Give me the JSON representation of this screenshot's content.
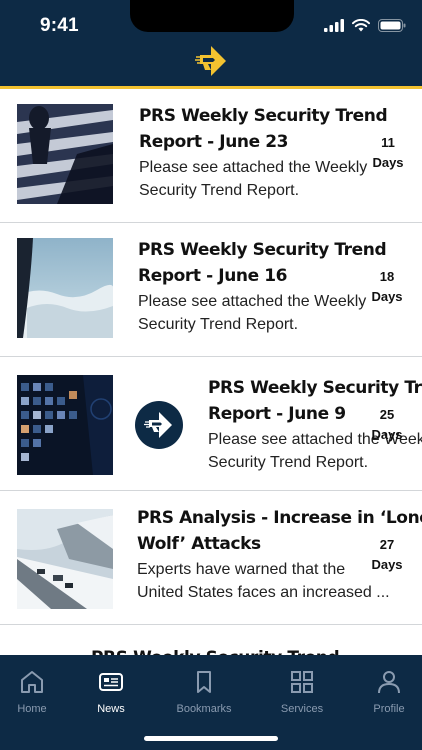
{
  "status_bar": {
    "time": "9:41"
  },
  "colors": {
    "navy": "#0d2a45",
    "accent": "#f2c230",
    "tab_inactive": "#8a9bb0"
  },
  "articles": [
    {
      "title_line1": "PRS Weekly Security Trend",
      "title_line2": "Report - June 23",
      "desc_line1": "Please see attached the Weekly",
      "desc_line2": "Security Trend Report.",
      "days_num": "11",
      "days_label": "Days",
      "thumb": "crosswalk-pedestrian-image"
    },
    {
      "title_line1": "PRS Weekly Security Trend",
      "title_line2": "Report - June 16",
      "desc_line1": "Please see attached the Weekly",
      "desc_line2": "Security Trend Report.",
      "days_num": "18",
      "days_label": "Days",
      "thumb": "aerial-clouds-image"
    },
    {
      "title_line1": "PRS Weekly Security Trend",
      "title_line2": "Report - June 9",
      "desc_line1": "Please see attached the Weekly",
      "desc_line2": "Security Trend Report.",
      "days_num": "25",
      "days_label": "Days",
      "thumb": "surveillance-screens-image"
    },
    {
      "title_line1": "PRS Analysis - Increase in ‘Lone",
      "title_line2": "Wolf’ Attacks",
      "desc_line1": "Experts have warned that the",
      "desc_line2": "United States faces an increased ...",
      "days_num": "27",
      "days_label": "Days",
      "thumb": "snowy-highway-image"
    },
    {
      "title_line1": "PRS Weekly Security Trend"
    }
  ],
  "tabs": [
    {
      "label": "Home",
      "icon": "home-icon"
    },
    {
      "label": "News",
      "icon": "news-icon",
      "active": true
    },
    {
      "label": "Bookmarks",
      "icon": "bookmark-icon"
    },
    {
      "label": "Services",
      "icon": "grid-icon"
    },
    {
      "label": "Profile",
      "icon": "person-icon"
    }
  ]
}
